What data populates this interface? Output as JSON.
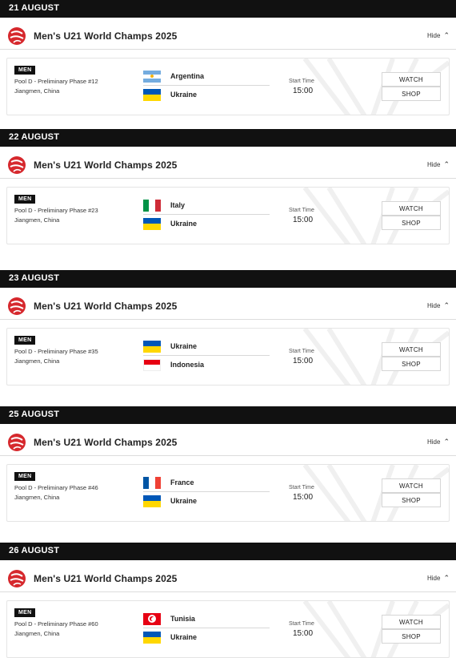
{
  "sections": [
    {
      "date": "21 AUGUST",
      "competition": "Men's U21 World Champs 2025",
      "hide_label": "Hide",
      "match": {
        "gender": "MEN",
        "phase": "Pool D - Preliminary Phase #12",
        "venue": "Jiangmen, China",
        "home": {
          "name": "Argentina",
          "flag": "argentina-flag"
        },
        "away": {
          "name": "Ukraine",
          "flag": "ukraine-flag"
        },
        "start_label": "Start Time",
        "start_time": "15:00",
        "watch_label": "WATCH",
        "shop_label": "SHOP"
      }
    },
    {
      "date": "22 AUGUST",
      "competition": "Men's U21 World Champs 2025",
      "hide_label": "Hide",
      "match": {
        "gender": "MEN",
        "phase": "Pool D - Preliminary Phase #23",
        "venue": "Jiangmen, China",
        "home": {
          "name": "Italy",
          "flag": "italy-flag"
        },
        "away": {
          "name": "Ukraine",
          "flag": "ukraine-flag"
        },
        "start_label": "Start Time",
        "start_time": "15:00",
        "watch_label": "WATCH",
        "shop_label": "SHOP"
      }
    },
    {
      "date": "23 AUGUST",
      "competition": "Men's U21 World Champs 2025",
      "hide_label": "Hide",
      "match": {
        "gender": "MEN",
        "phase": "Pool D - Preliminary Phase #35",
        "venue": "Jiangmen, China",
        "home": {
          "name": "Ukraine",
          "flag": "ukraine-flag"
        },
        "away": {
          "name": "Indonesia",
          "flag": "indonesia-flag"
        },
        "start_label": "Start Time",
        "start_time": "15:00",
        "watch_label": "WATCH",
        "shop_label": "SHOP"
      }
    },
    {
      "date": "25 AUGUST",
      "competition": "Men's U21 World Champs 2025",
      "hide_label": "Hide",
      "match": {
        "gender": "MEN",
        "phase": "Pool D - Preliminary Phase #46",
        "venue": "Jiangmen, China",
        "home": {
          "name": "France",
          "flag": "france-flag"
        },
        "away": {
          "name": "Ukraine",
          "flag": "ukraine-flag"
        },
        "start_label": "Start Time",
        "start_time": "15:00",
        "watch_label": "WATCH",
        "shop_label": "SHOP"
      }
    },
    {
      "date": "26 AUGUST",
      "competition": "Men's U21 World Champs 2025",
      "hide_label": "Hide",
      "match": {
        "gender": "MEN",
        "phase": "Pool D - Preliminary Phase #60",
        "venue": "Jiangmen, China",
        "home": {
          "name": "Tunisia",
          "flag": "tunisia-flag"
        },
        "away": {
          "name": "Ukraine",
          "flag": "ukraine-flag"
        },
        "start_label": "Start Time",
        "start_time": "15:00",
        "watch_label": "WATCH",
        "shop_label": "SHOP"
      }
    }
  ],
  "colors": {
    "date_bar": "#111111",
    "logo_red": "#d6282d",
    "ukraine_blue": "#0057b7",
    "ukraine_yellow": "#ffd700",
    "argentina_blue": "#74acdf",
    "italy_green": "#009246",
    "italy_red": "#ce2b37",
    "indonesia_red": "#e70011",
    "france_blue": "#0055a4",
    "france_red": "#ef4135",
    "tunisia_red": "#e70013"
  }
}
